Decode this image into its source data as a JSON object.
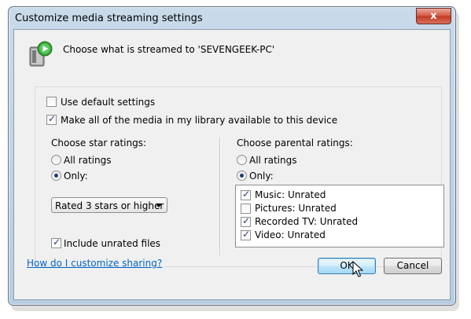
{
  "window": {
    "title": "Customize media streaming settings",
    "close_glyph": "x"
  },
  "header": {
    "text": "Choose what is streamed to 'SEVENGEEK-PC'",
    "icon": "media-device-icon"
  },
  "options": {
    "use_default": {
      "label": "Use default settings",
      "checked": false
    },
    "make_all_available": {
      "label": "Make all of the media in my library available to this device",
      "checked": true
    }
  },
  "star_ratings": {
    "heading": "Choose star ratings:",
    "all_label": "All ratings",
    "only_label": "Only:",
    "selected": "Only:",
    "dropdown_value": "Rated 3 stars or higher",
    "include_unrated": {
      "label": "Include unrated files",
      "checked": true
    }
  },
  "parental_ratings": {
    "heading": "Choose parental ratings:",
    "all_label": "All ratings",
    "only_label": "Only:",
    "selected": "Only:",
    "items": [
      {
        "label": "Music: Unrated",
        "checked": true
      },
      {
        "label": "Pictures: Unrated",
        "checked": false
      },
      {
        "label": "Recorded TV: Unrated",
        "checked": true
      },
      {
        "label": "Video: Unrated",
        "checked": true
      }
    ]
  },
  "footer": {
    "help_link": "How do I customize sharing?",
    "ok_label": "OK",
    "cancel_label": "Cancel"
  }
}
